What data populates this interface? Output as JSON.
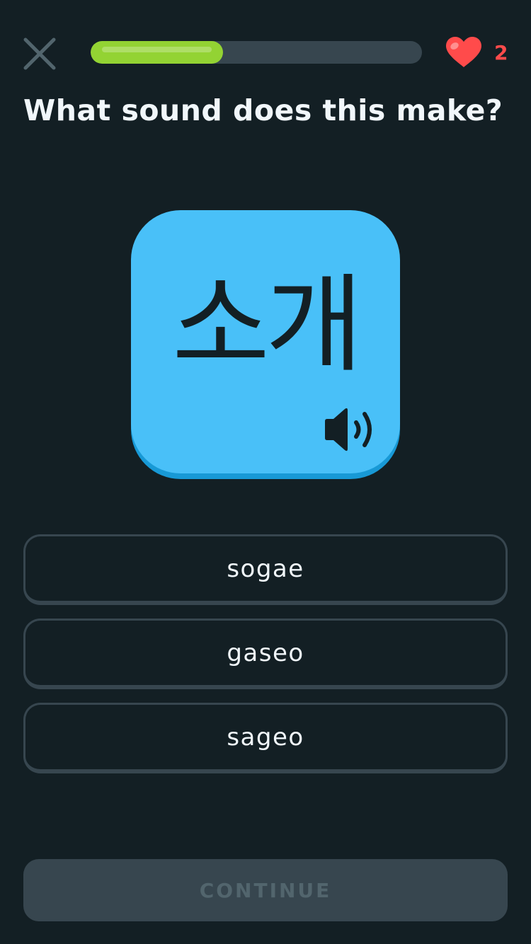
{
  "header": {
    "close_icon": "close-icon",
    "progress": 0.4,
    "hearts": {
      "icon": "heart-icon",
      "count": "2"
    }
  },
  "question": "What sound does this make?",
  "character_card": {
    "character": "소개",
    "audio_icon": "speaker-icon"
  },
  "options": [
    {
      "label": "sogae"
    },
    {
      "label": "gaseo"
    },
    {
      "label": "sageo"
    }
  ],
  "continue_button": {
    "label": "CONTINUE",
    "enabled": false
  },
  "colors": {
    "background": "#131f24",
    "progress_fill": "#93d333",
    "progress_track": "#37464f",
    "heart": "#ff4b4b",
    "card": "#49c0f8",
    "card_shadow": "#1899d6",
    "option_border": "#37464f",
    "text": "#f1f7fb",
    "disabled_button": "#37464f",
    "disabled_text": "#52656d"
  }
}
